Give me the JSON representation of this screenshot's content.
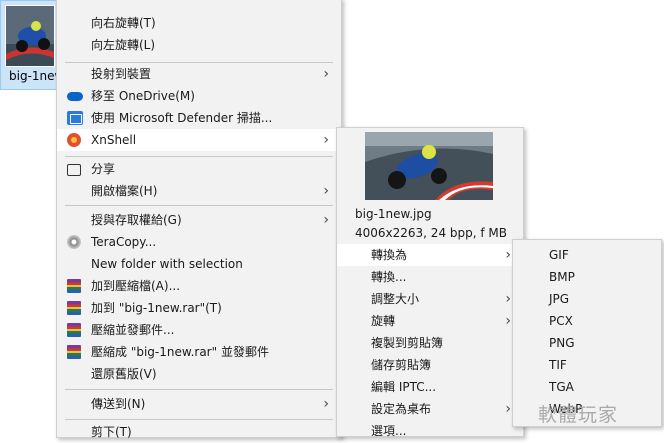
{
  "file": {
    "name": "big-1new"
  },
  "main_menu": {
    "items": [
      {
        "label": "向右旋轉(T)"
      },
      {
        "label": "向左旋轉(L)"
      },
      {
        "label": "投射到裝置"
      },
      {
        "label": "移至 OneDrive(M)"
      },
      {
        "label": "使用 Microsoft Defender 掃描..."
      },
      {
        "label": "XnShell"
      },
      {
        "label": "分享"
      },
      {
        "label": "開啟檔案(H)"
      },
      {
        "label": "授與存取權給(G)"
      },
      {
        "label": "TeraCopy..."
      },
      {
        "label": "New folder with selection"
      },
      {
        "label": "加到壓縮檔(A)..."
      },
      {
        "label": "加到 \"big-1new.rar\"(T)"
      },
      {
        "label": "壓縮並發郵件..."
      },
      {
        "label": "壓縮成 \"big-1new.rar\" 並發郵件"
      },
      {
        "label": "還原舊版(V)"
      },
      {
        "label": "傳送到(N)"
      },
      {
        "label": "剪下(T)"
      }
    ]
  },
  "xnshell": {
    "filename": "big-1new.jpg",
    "details": "4006x2263, 24 bpp, f MB",
    "items": [
      {
        "label": "轉換為"
      },
      {
        "label": "轉換..."
      },
      {
        "label": "調整大小"
      },
      {
        "label": "旋轉"
      },
      {
        "label": "複製到剪貼簿"
      },
      {
        "label": "儲存剪貼簿"
      },
      {
        "label": "編輯 IPTC..."
      },
      {
        "label": "設定為桌布"
      },
      {
        "label": "選項..."
      }
    ]
  },
  "convert_formats": [
    "GIF",
    "BMP",
    "JPG",
    "PCX",
    "PNG",
    "TIF",
    "TGA",
    "WebP"
  ],
  "watermark": "軟體玩家",
  "icons": {
    "submenu_arrow": "chevron-right-icon",
    "onedrive": "cloud-icon",
    "defender": "shield-icon",
    "xnshell": "xnshell-icon",
    "share": "share-icon",
    "teracopy": "cd-icon",
    "winrar": "winrar-icon"
  },
  "colors": {
    "menu_bg": "#f2f2f2",
    "highlight": "#ffffff",
    "selection": "#cce4f7"
  }
}
